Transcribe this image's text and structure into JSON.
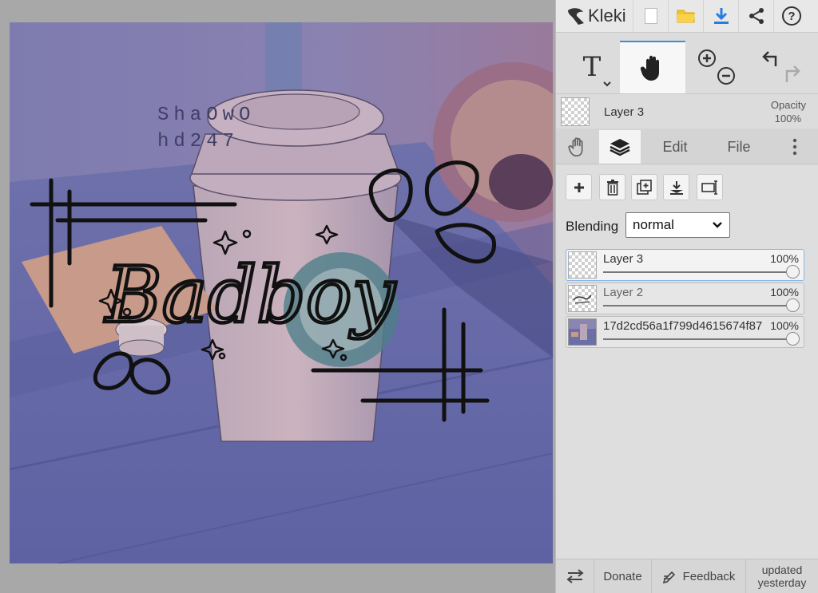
{
  "app": {
    "name": "Kleki"
  },
  "artwork": {
    "title_text": "Badboy",
    "watermark_line1": "ShaOwO",
    "watermark_line2": "hd247"
  },
  "topbar": {
    "icons": [
      "new-file-icon",
      "open-folder-icon",
      "download-icon",
      "share-icon",
      "help-icon"
    ]
  },
  "tools": {
    "text_tool": "T"
  },
  "layer_header": {
    "name": "Layer 3",
    "opacity_label": "Opacity",
    "opacity_value": "100%"
  },
  "tabs": {
    "edit": "Edit",
    "file": "File"
  },
  "blending": {
    "label": "Blending",
    "value": "normal"
  },
  "layers": [
    {
      "name": "Layer 3",
      "opacity": "100%",
      "selected": true
    },
    {
      "name": "Layer 2",
      "opacity": "100%",
      "selected": false
    },
    {
      "name": "17d2cd56a1f799d4615674f87",
      "opacity": "100%",
      "selected": false
    }
  ],
  "footer": {
    "donate": "Donate",
    "feedback": "Feedback",
    "updated_line1": "updated",
    "updated_line2": "yesterday"
  },
  "colors": {
    "accent": "#3d8fd9",
    "panel_bg": "#dedede",
    "canvas_tint": "#6a6aa8"
  }
}
